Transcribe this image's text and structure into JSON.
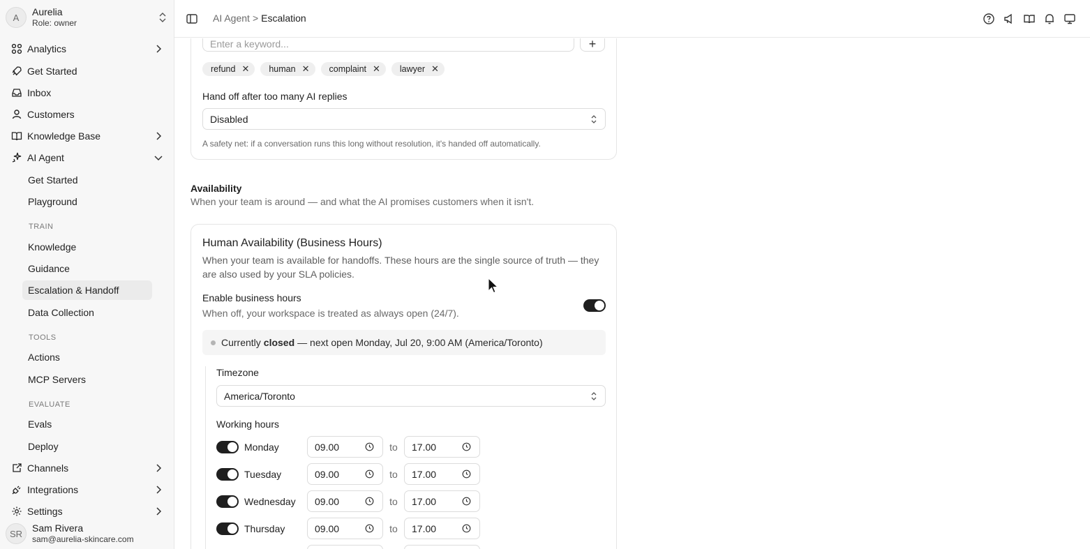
{
  "org": {
    "initial": "A",
    "name": "Aurelia",
    "role": "Role: owner"
  },
  "nav": {
    "analytics": "Analytics",
    "get_started": "Get Started",
    "inbox": "Inbox",
    "customers": "Customers",
    "knowledge_base": "Knowledge Base",
    "ai_agent": "AI Agent",
    "channels": "Channels",
    "integrations": "Integrations",
    "settings": "Settings"
  },
  "ai_agent_sub": {
    "get_started": "Get Started",
    "playground": "Playground",
    "train_heading": "TRAIN",
    "knowledge": "Knowledge",
    "guidance": "Guidance",
    "escalation": "Escalation & Handoff",
    "data_collection": "Data Collection",
    "tools_heading": "TOOLS",
    "actions": "Actions",
    "mcp_servers": "MCP Servers",
    "evaluate_heading": "EVALUATE",
    "evals": "Evals",
    "deploy": "Deploy"
  },
  "user": {
    "initials": "SR",
    "name": "Sam Rivera",
    "email": "sam@aurelia-skincare.com"
  },
  "breadcrumb": {
    "parent": "AI Agent",
    "separator": ">",
    "current": "Escalation"
  },
  "keywords": {
    "placeholder": "Enter a keyword...",
    "add_label": "+",
    "chips": [
      "refund",
      "human",
      "complaint",
      "lawyer"
    ],
    "remove_glyph": "✕"
  },
  "handoff": {
    "label": "Hand off after too many AI replies",
    "value": "Disabled",
    "help": "A safety net: if a conversation runs this long without resolution, it's handed off automatically."
  },
  "availability": {
    "title": "Availability",
    "subtitle": "When your team is around — and what the AI promises customers when it isn't."
  },
  "business_hours": {
    "title": "Human Availability (Business Hours)",
    "description": "When your team is available for handoffs. These hours are the single source of truth — they are also used by your SLA policies.",
    "enable_label": "Enable business hours",
    "enable_sub": "When off, your workspace is treated as always open (24/7).",
    "enabled": true,
    "status_prefix": "Currently",
    "status_state": "closed",
    "status_suffix": "— next open Monday, Jul 20, 9:00 AM (America/Toronto)",
    "timezone_label": "Timezone",
    "timezone_value": "America/Toronto",
    "working_hours_label": "Working hours",
    "to_label": "to",
    "days": [
      {
        "name": "Monday",
        "enabled": true,
        "start": "09.00",
        "end": "17.00"
      },
      {
        "name": "Tuesday",
        "enabled": true,
        "start": "09.00",
        "end": "17.00"
      },
      {
        "name": "Wednesday",
        "enabled": true,
        "start": "09.00",
        "end": "17.00"
      },
      {
        "name": "Thursday",
        "enabled": true,
        "start": "09.00",
        "end": "17.00"
      }
    ]
  }
}
